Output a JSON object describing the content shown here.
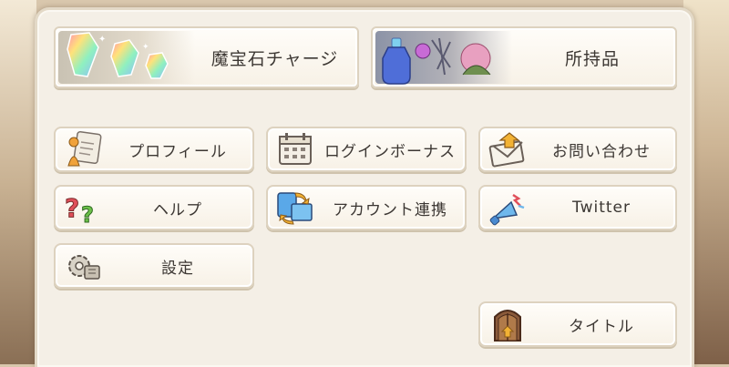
{
  "menu": {
    "gem_charge": "魔宝石チャージ",
    "inventory": "所持品",
    "profile": "プロフィール",
    "login_bonus": "ログインボーナス",
    "contact": "お問い合わせ",
    "help": "ヘルプ",
    "account_link": "アカウント連携",
    "twitter": "Twitter",
    "settings": "設定",
    "title": "タイトル"
  },
  "icons": {
    "gem_charge": "rainbow-gem-icon",
    "inventory": "potion-items-icon",
    "profile": "profile-card-icon",
    "login_bonus": "calendar-icon",
    "contact": "mail-icon",
    "help": "question-marks-icon",
    "account_link": "account-link-icon",
    "twitter": "megaphone-icon",
    "settings": "gear-icon",
    "title": "door-icon"
  }
}
